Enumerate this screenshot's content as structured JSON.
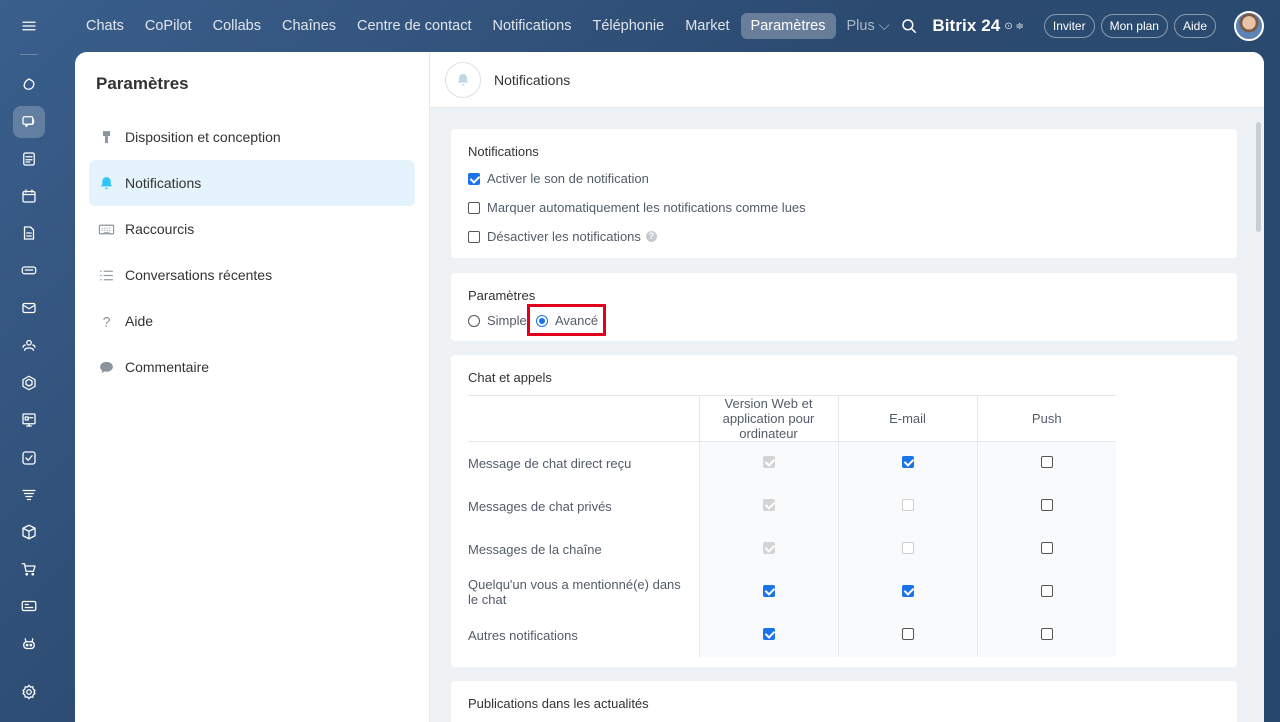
{
  "rail": {
    "items": [
      {
        "name": "menu-icon",
        "active": false
      },
      {
        "name": "copilot-icon",
        "active": false
      },
      {
        "name": "chat-icon",
        "active": true
      },
      {
        "name": "feed-icon",
        "active": false
      },
      {
        "name": "calendar-icon",
        "active": false
      },
      {
        "name": "document-icon",
        "active": false
      },
      {
        "name": "drive-icon",
        "active": false
      },
      {
        "name": "mail-icon",
        "active": false
      },
      {
        "name": "contacts-icon",
        "active": false
      },
      {
        "name": "hexagon-icon",
        "active": false
      },
      {
        "name": "board-icon",
        "active": false
      },
      {
        "name": "tasks-icon",
        "active": false
      },
      {
        "name": "funnel-icon",
        "active": false
      },
      {
        "name": "box-icon",
        "active": false
      },
      {
        "name": "cart-icon",
        "active": false
      },
      {
        "name": "card-icon",
        "active": false
      },
      {
        "name": "robot-icon",
        "active": false
      },
      {
        "name": "settings-gear-icon",
        "active": false
      }
    ]
  },
  "topnav": {
    "tabs": [
      {
        "label": "Chats",
        "active": false
      },
      {
        "label": "CoPilot",
        "active": false
      },
      {
        "label": "Collabs",
        "active": false
      },
      {
        "label": "Chaînes",
        "active": false
      },
      {
        "label": "Centre de contact",
        "active": false
      },
      {
        "label": "Notifications",
        "active": false
      },
      {
        "label": "Téléphonie",
        "active": false
      },
      {
        "label": "Market",
        "active": false
      },
      {
        "label": "Paramètres",
        "active": true
      },
      {
        "label": "Plus ⌵",
        "active": false
      }
    ],
    "brand": "Bitrix 24",
    "brand_mark": "⊙ ≑",
    "invite": "Inviter",
    "my_plan": "Mon plan",
    "help": "Aide"
  },
  "sidebar": {
    "title": "Paramètres",
    "items": [
      {
        "label": "Disposition et conception",
        "icon": "brush-icon",
        "active": false
      },
      {
        "label": "Notifications",
        "icon": "bell-icon",
        "active": true
      },
      {
        "label": "Raccourcis",
        "icon": "keyboard-icon",
        "active": false
      },
      {
        "label": "Conversations récentes",
        "icon": "list-icon",
        "active": false
      },
      {
        "label": "Aide",
        "icon": "question-icon",
        "active": false
      },
      {
        "label": "Commentaire",
        "icon": "comment-icon",
        "active": false
      }
    ]
  },
  "header": {
    "title": "Notifications"
  },
  "notifications_card": {
    "title": "Notifications",
    "options": [
      {
        "label": "Activer le son de notification",
        "checked": true
      },
      {
        "label": "Marquer automatiquement les notifications comme lues",
        "checked": false
      },
      {
        "label": "Désactiver les notifications",
        "checked": false,
        "help": "?"
      }
    ]
  },
  "mode_card": {
    "title": "Paramètres",
    "options": [
      {
        "label": "Simple",
        "selected": false
      },
      {
        "label": "Avancé",
        "selected": true
      }
    ]
  },
  "chat_card": {
    "title": "Chat et appels",
    "columns": [
      "",
      "Version Web et application pour ordinateur",
      "E-mail",
      "Push"
    ],
    "rows": [
      {
        "label": "Message de chat direct reçu",
        "cells": [
          "disabled-checked",
          "checked",
          "unchecked"
        ]
      },
      {
        "label": "Messages de chat privés",
        "cells": [
          "disabled-checked",
          "disabled",
          "unchecked"
        ]
      },
      {
        "label": "Messages de la chaîne",
        "cells": [
          "disabled-checked",
          "disabled",
          "unchecked"
        ]
      },
      {
        "label": "Quelqu'un vous a mentionné(e) dans le chat",
        "cells": [
          "checked",
          "checked",
          "unchecked"
        ]
      },
      {
        "label": "Autres notifications",
        "cells": [
          "checked",
          "unchecked",
          "unchecked"
        ]
      }
    ]
  },
  "news_card": {
    "title": "Publications dans les actualités"
  },
  "colors": {
    "accent": "#2fc6f6",
    "checkbox": "#1a73e8",
    "highlight": "#e0001b"
  }
}
